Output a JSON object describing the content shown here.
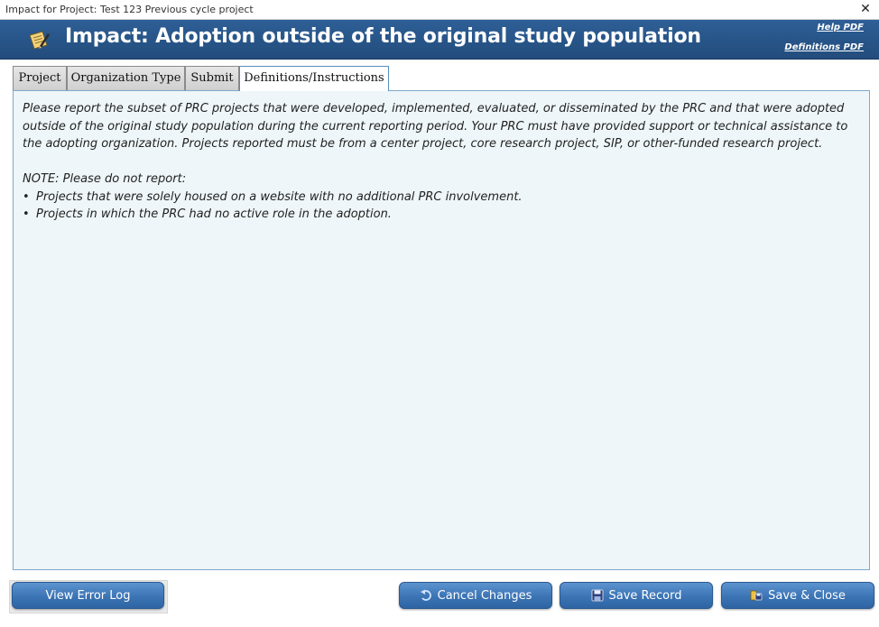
{
  "window": {
    "title": "Impact for Project: Test 123 Previous cycle project",
    "close_glyph": "✕"
  },
  "header": {
    "logo_icon": "notepad-pencil-icon",
    "title": "Impact: Adoption outside of the original study population",
    "help_link": "Help PDF",
    "definitions_link": "Definitions PDF",
    "bg_color": "#2a5a8e"
  },
  "tabs": [
    {
      "label": "Project",
      "active": false
    },
    {
      "label": "Organization Type",
      "active": false
    },
    {
      "label": "Submit",
      "active": false
    },
    {
      "label": "Definitions/Instructions",
      "active": true
    }
  ],
  "content": {
    "intro": "Please report the subset of PRC projects that were developed, implemented, evaluated, or disseminated by the PRC and that were adopted outside of the original study population during the current reporting period. Your PRC must have provided support or technical assistance to the adopting organization. Projects reported must be from a center project, core research project, SIP, or other-funded research project.",
    "note_heading": "NOTE: Please do not report:",
    "bullet_glyph": "•",
    "bullets": [
      "Projects that were solely housed on a website with no additional PRC involvement.",
      "Projects in which the PRC had no active role in the adoption."
    ]
  },
  "buttons": {
    "view_error_log": "View Error Log",
    "cancel_changes": "Cancel Changes",
    "save_record": "Save Record",
    "save_close": "Save & Close"
  }
}
